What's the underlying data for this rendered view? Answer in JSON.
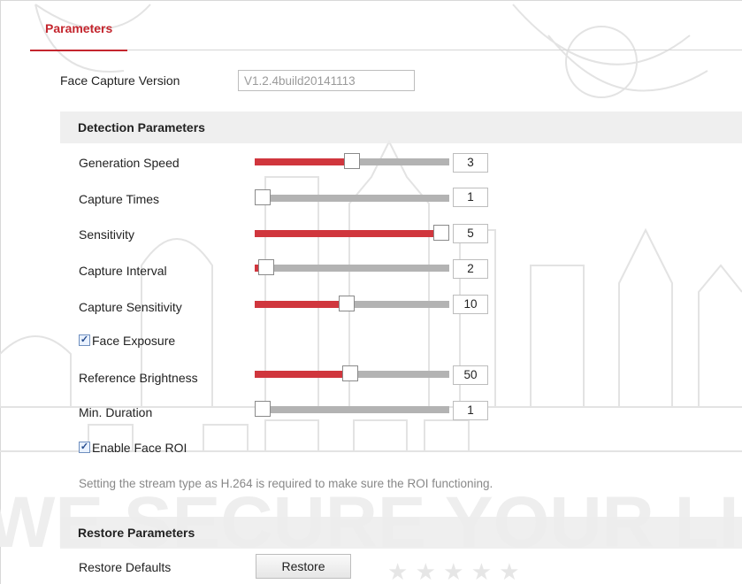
{
  "tabs": [
    {
      "label": "Parameters",
      "active": true
    }
  ],
  "face_capture_version": {
    "label": "Face Capture Version",
    "value": "V1.2.4build20141113"
  },
  "detection": {
    "title": "Detection Parameters",
    "sliders": [
      {
        "label": "Generation Speed",
        "value": "3",
        "level": 0.5
      },
      {
        "label": "Capture Times",
        "value": "1",
        "level": 0.0
      },
      {
        "label": "Sensitivity",
        "value": "5",
        "level": 1.0
      },
      {
        "label": "Capture Interval",
        "value": "2",
        "level": 0.02
      },
      {
        "label": "Capture Sensitivity",
        "value": "10",
        "level": 0.47
      }
    ],
    "face_exposure": {
      "label": "Face Exposure",
      "checked": true
    },
    "exposure_sliders": [
      {
        "label": "Reference Brightness",
        "value": "50",
        "level": 0.49
      },
      {
        "label": "Min. Duration",
        "value": "1",
        "level": 0.0
      }
    ],
    "enable_roi": {
      "label": "Enable Face ROI",
      "checked": true
    },
    "roi_note": "Setting the stream type as H.264 is required to make sure the ROI functioning."
  },
  "restore": {
    "title": "Restore Parameters",
    "label": "Restore Defaults",
    "button": "Restore"
  },
  "watermark_text": "WE SECURE YOUR LIFE",
  "colors": {
    "accent": "#c4262e",
    "slider_fill": "#d0363d",
    "track": "#b3b3b3"
  }
}
